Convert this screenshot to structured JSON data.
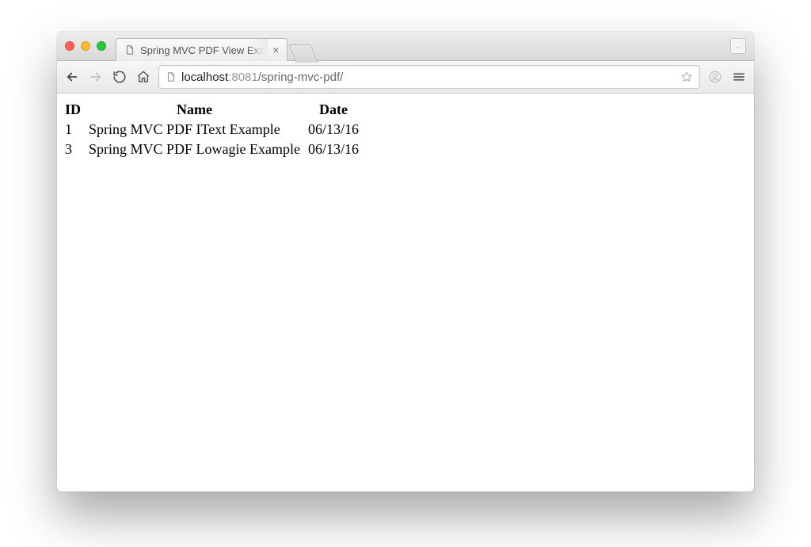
{
  "window": {
    "traffic": [
      "close",
      "minimize",
      "zoom"
    ]
  },
  "tab": {
    "title": "Spring MVC PDF View Exa"
  },
  "address": {
    "host": "localhost",
    "port": ":8081",
    "path": "/spring-mvc-pdf/"
  },
  "title_right_label": ".",
  "table": {
    "headers": [
      "ID",
      "Name",
      "Date"
    ],
    "rows": [
      {
        "id": "1",
        "name": "Spring MVC PDF IText Example",
        "date": "06/13/16"
      },
      {
        "id": "3",
        "name": "Spring MVC PDF Lowagie Example",
        "date": "06/13/16"
      }
    ]
  }
}
